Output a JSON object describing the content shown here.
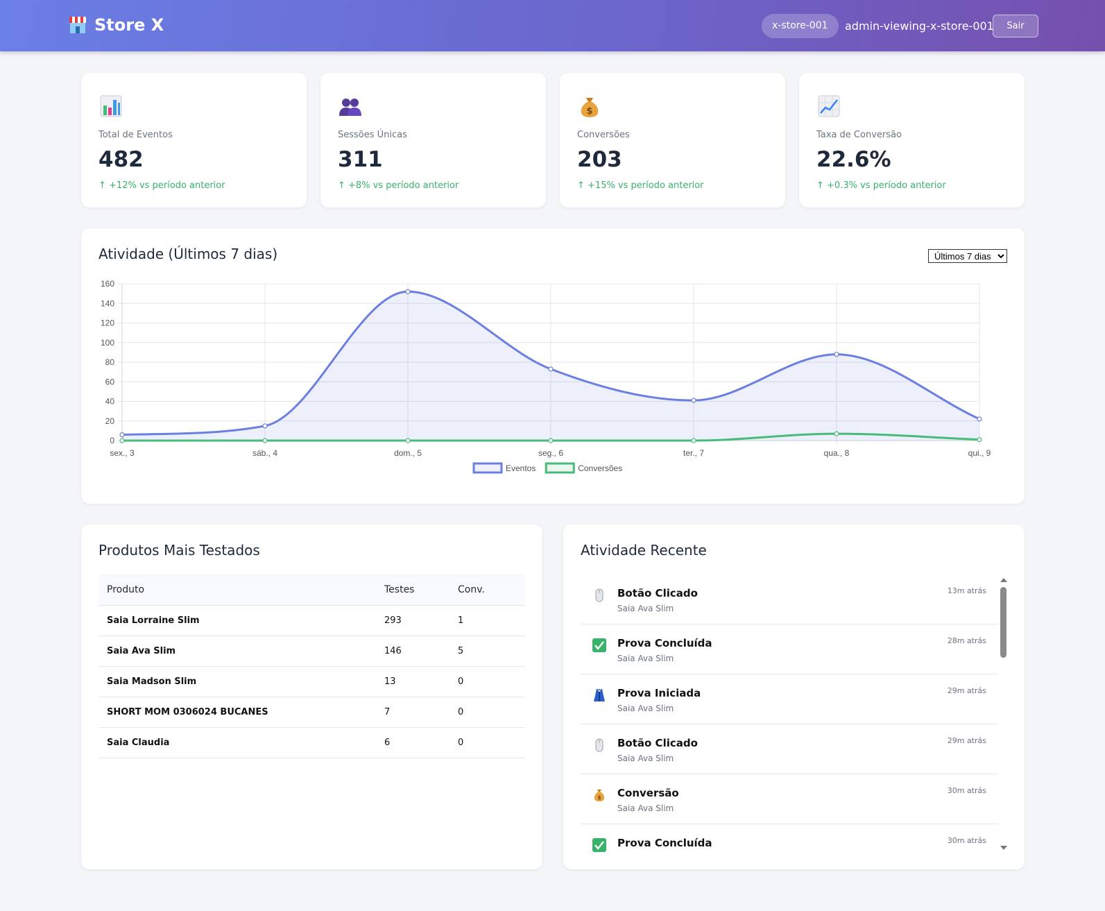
{
  "header": {
    "brand": "Store X",
    "store_id": "x-store-001",
    "user": "admin-viewing-x-store-001",
    "logout_label": "Sair"
  },
  "stats": [
    {
      "icon": "bar-chart-icon",
      "label": "Total de Eventos",
      "value": "482",
      "delta": "↑ +12% vs período anterior"
    },
    {
      "icon": "users-icon",
      "label": "Sessões Únicas",
      "value": "311",
      "delta": "↑ +8% vs período anterior"
    },
    {
      "icon": "money-bag-icon",
      "label": "Conversões",
      "value": "203",
      "delta": "↑ +15% vs período anterior"
    },
    {
      "icon": "trend-up-icon",
      "label": "Taxa de Conversão",
      "value": "22.6%",
      "delta": "↑ +0.3% vs período anterior"
    }
  ],
  "activity": {
    "title": "Atividade (Últimos 7 dias)",
    "range_selected": "Últimos 7 dias"
  },
  "chart_data": {
    "type": "line",
    "x": [
      "sex., 3",
      "sáb., 4",
      "dom., 5",
      "seg., 6",
      "ter., 7",
      "qua., 8",
      "qui., 9"
    ],
    "series": [
      {
        "name": "Eventos",
        "values": [
          6,
          15,
          152,
          73,
          41,
          88,
          22
        ],
        "color": "#6b7fe0",
        "fill": true
      },
      {
        "name": "Conversões",
        "values": [
          0,
          0,
          0,
          0,
          0,
          7,
          1
        ],
        "color": "#48bb78",
        "fill": false
      }
    ],
    "ylim": [
      0,
      160
    ],
    "yticks": [
      0,
      20,
      40,
      60,
      80,
      100,
      120,
      140,
      160
    ],
    "grid": true,
    "legend": "bottom-center"
  },
  "products": {
    "title": "Produtos Mais Testados",
    "columns": [
      "Produto",
      "Testes",
      "Conv."
    ],
    "rows": [
      [
        "Saia Lorraine Slim",
        "293",
        "1"
      ],
      [
        "Saia Ava Slim",
        "146",
        "5"
      ],
      [
        "Saia Madson Slim",
        "13",
        "0"
      ],
      [
        "SHORT MOM 0306024 BUCANES",
        "7",
        "0"
      ],
      [
        "Saia Claudia",
        "6",
        "0"
      ]
    ]
  },
  "recent": {
    "title": "Atividade Recente",
    "items": [
      {
        "icon": "mouse-icon",
        "title": "Botão Clicado",
        "product": "Saia Ava Slim",
        "time": "13m atrás"
      },
      {
        "icon": "check-icon",
        "title": "Prova Concluída",
        "product": "Saia Ava Slim",
        "time": "28m atrás"
      },
      {
        "icon": "dress-icon",
        "title": "Prova Iniciada",
        "product": "Saia Ava Slim",
        "time": "29m atrás"
      },
      {
        "icon": "mouse-icon",
        "title": "Botão Clicado",
        "product": "Saia Ava Slim",
        "time": "29m atrás"
      },
      {
        "icon": "money-bag-icon",
        "title": "Conversão",
        "product": "Saia Ava Slim",
        "time": "30m atrás"
      },
      {
        "icon": "check-icon",
        "title": "Prova Concluída",
        "product": "",
        "time": "30m atrás"
      }
    ]
  }
}
